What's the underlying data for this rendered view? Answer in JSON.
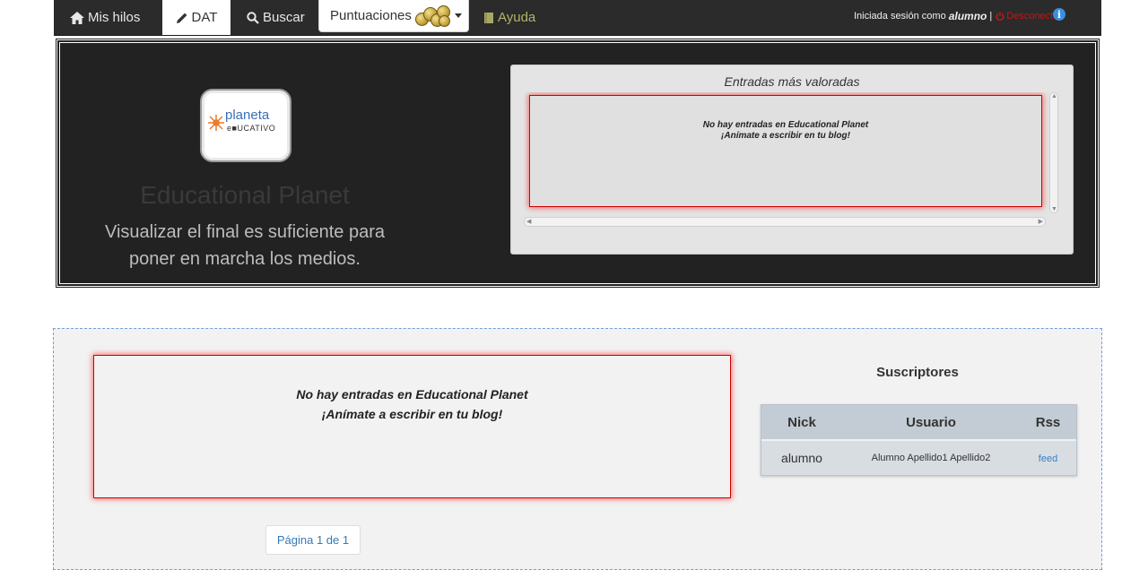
{
  "nav": {
    "items": [
      {
        "label": "Mis hilos",
        "icon": "home-icon"
      },
      {
        "label": "DAT",
        "icon": "pencil-icon"
      },
      {
        "label": "Buscar",
        "icon": "search-icon"
      }
    ],
    "scores_label": "Puntuaciones",
    "help_label": "Ayuda",
    "session_prefix": "Iniciada sesión como",
    "username": "alumno",
    "separator": "|",
    "logout_label": "Desconectar"
  },
  "hero": {
    "logo_text": "planeta",
    "logo_subtext": "e■UCATIVO",
    "title": "Educational Planet",
    "subtitle": "Visualizar el final es suficiente para poner en marcha los medios."
  },
  "top_entries": {
    "title": "Entradas más valoradas",
    "empty_line1": "No hay entradas en Educational Planet",
    "empty_line2": "¡Anímate a escribir en tu blog!"
  },
  "main": {
    "empty_line1": "No hay entradas en Educational Planet",
    "empty_line2": "¡Anímate a escribir en tu blog!",
    "pagination": "Página 1 de 1"
  },
  "subscribers": {
    "title": "Suscriptores",
    "headers": [
      "Nick",
      "Usuario",
      "Rss"
    ],
    "rows": [
      {
        "nick": "alumno",
        "usuario": "Alumno Apellido1 Apellido2",
        "rss": "feed"
      }
    ]
  }
}
